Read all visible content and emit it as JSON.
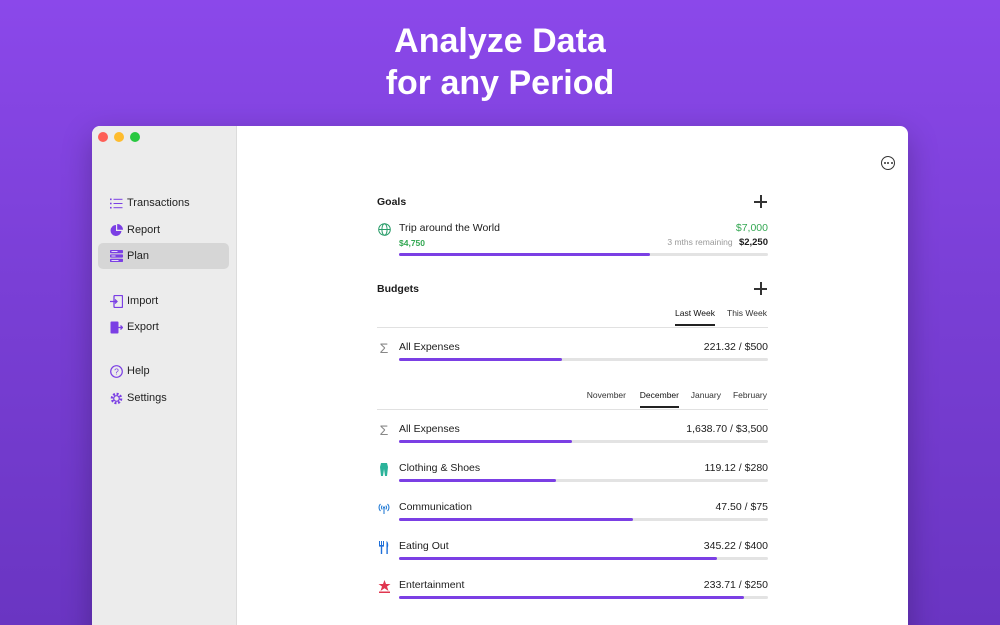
{
  "headline": {
    "line1": "Analyze Data",
    "line2": "for any Period"
  },
  "sidebar": {
    "items": [
      {
        "label": "Transactions",
        "icon": "list-icon"
      },
      {
        "label": "Report",
        "icon": "pie-chart-icon"
      },
      {
        "label": "Plan",
        "icon": "plan-icon",
        "active": true
      },
      {
        "label": "Import",
        "icon": "import-icon"
      },
      {
        "label": "Export",
        "icon": "export-icon"
      },
      {
        "label": "Help",
        "icon": "help-icon"
      },
      {
        "label": "Settings",
        "icon": "gear-icon"
      }
    ]
  },
  "goals": {
    "title": "Goals",
    "items": [
      {
        "name": "Trip around the World",
        "target": "$7,000",
        "saved": "$4,750",
        "remaining_label": "3 mths remaining",
        "remaining_amount": "$2,250",
        "progress": 0.679,
        "icon": "globe-icon"
      }
    ]
  },
  "budgets": {
    "title": "Budgets",
    "weekly_tabs": [
      "Last Week",
      "This Week"
    ],
    "weekly_active": "Last Week",
    "weekly": [
      {
        "name": "All Expenses",
        "amount": "221.32 / $500",
        "progress": 0.443,
        "icon": "sigma-icon"
      }
    ],
    "monthly_tabs": [
      "November",
      "December",
      "January",
      "February"
    ],
    "monthly_active": "December",
    "monthly": [
      {
        "name": "All Expenses",
        "amount": "1,638.70 / $3,500",
        "progress": 0.468,
        "icon": "sigma-icon"
      },
      {
        "name": "Clothing & Shoes",
        "amount": "119.12 / $280",
        "progress": 0.425,
        "icon": "clothing-icon"
      },
      {
        "name": "Communication",
        "amount": "47.50 / $75",
        "progress": 0.633,
        "icon": "antenna-icon"
      },
      {
        "name": "Eating Out",
        "amount": "345.22 / $400",
        "progress": 0.863,
        "icon": "fork-knife-icon"
      },
      {
        "name": "Entertainment",
        "amount": "233.71 / $250",
        "progress": 0.935,
        "icon": "entertainment-icon"
      }
    ]
  },
  "colors": {
    "accent": "#7b3fe4",
    "positive": "#34a853",
    "background_top": "#8b48ea"
  }
}
